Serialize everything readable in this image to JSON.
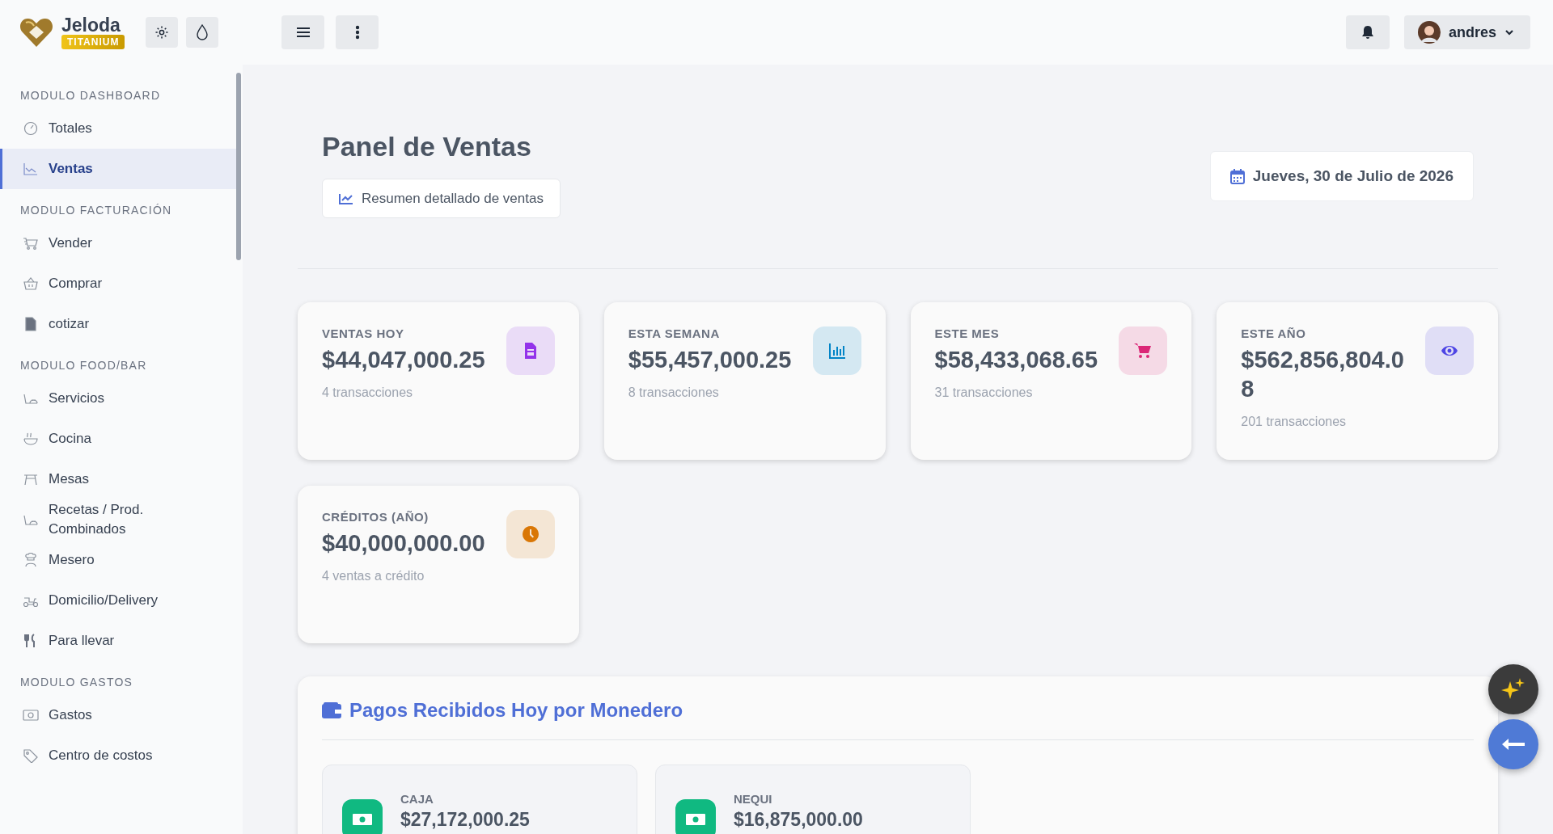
{
  "brand": {
    "name": "Jeloda",
    "tier": "TITANIUM"
  },
  "header": {
    "user": "andres"
  },
  "sidebar": {
    "sections": [
      {
        "title": "MODULO DASHBOARD",
        "items": [
          {
            "label": "Totales",
            "selected": false
          },
          {
            "label": "Ventas",
            "selected": true
          }
        ]
      },
      {
        "title": "MODULO FACTURACIÓN",
        "items": [
          {
            "label": "Vender",
            "selected": false
          },
          {
            "label": "Comprar",
            "selected": false
          },
          {
            "label": "cotizar",
            "selected": false
          }
        ]
      },
      {
        "title": "MODULO FOOD/BAR",
        "items": [
          {
            "label": "Servicios",
            "selected": false
          },
          {
            "label": "Cocina",
            "selected": false
          },
          {
            "label": "Mesas",
            "selected": false
          },
          {
            "label": "Recetas / Prod. Combinados",
            "selected": false
          },
          {
            "label": "Mesero",
            "selected": false
          },
          {
            "label": "Domicilio/Delivery",
            "selected": false
          },
          {
            "label": "Para llevar",
            "selected": false
          }
        ]
      },
      {
        "title": "MODULO GASTOS",
        "items": [
          {
            "label": "Gastos",
            "selected": false
          },
          {
            "label": "Centro de costos",
            "selected": false
          }
        ]
      }
    ]
  },
  "page": {
    "title": "Panel de Ventas",
    "summary_button": "Resumen detallado de ventas",
    "date": "Jueves, 30 de Julio de 2026"
  },
  "stats": [
    {
      "label": "VENTAS HOY",
      "value": "$44,047,000.25",
      "note": "4 transacciones",
      "color": "#9333ea"
    },
    {
      "label": "ESTA SEMANA",
      "value": "$55,457,000.25",
      "note": "8 transacciones",
      "color": "#0284c7"
    },
    {
      "label": "ESTE MES",
      "value": "$58,433,068.65",
      "note": "31 transacciones",
      "color": "#db2777"
    },
    {
      "label": "ESTE AÑO",
      "value": "$562,856,804.08",
      "note": "201 transacciones",
      "color": "#4f46e5"
    },
    {
      "label": "CRÉDITOS (AÑO)",
      "value": "$40,000,000.00",
      "note": "4 ventas a crédito",
      "color": "#d97706"
    }
  ],
  "wallets": {
    "title": "Pagos Recibidos Hoy por Monedero",
    "items": [
      {
        "label": "CAJA",
        "value": "$27,172,000.25"
      },
      {
        "label": "NEQUI",
        "value": "$16,875,000.00"
      }
    ]
  }
}
